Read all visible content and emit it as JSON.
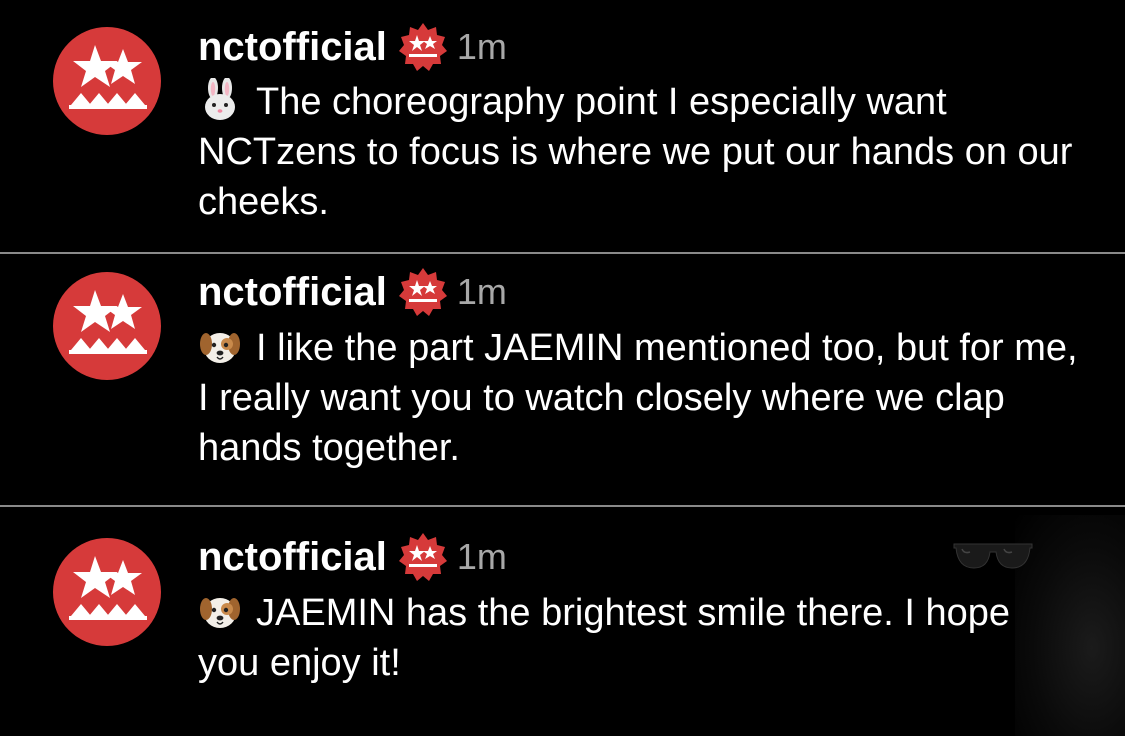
{
  "comments": [
    {
      "username": "nctofficial",
      "time": "1m",
      "emoji_icon": "rabbit-face-icon",
      "text": "The choreography point I especially want NCTzens to focus is where we put our hands on our cheeks."
    },
    {
      "username": "nctofficial",
      "time": "1m",
      "emoji_icon": "dog-face-icon",
      "text": "I like the part JAEMIN mentioned too, but for me, I really want you to watch closely where we clap hands together."
    },
    {
      "username": "nctofficial",
      "time": "1m",
      "emoji_icon": "dog-face-icon",
      "text": "JAEMIN has the brightest smile there. I hope you enjoy it!"
    }
  ],
  "colors": {
    "background": "#000000",
    "avatar_red": "#d63a3a",
    "badge_red": "#d63a3a",
    "timestamp_gray": "#a8a8a8",
    "divider_gray": "#8a8a8a"
  }
}
